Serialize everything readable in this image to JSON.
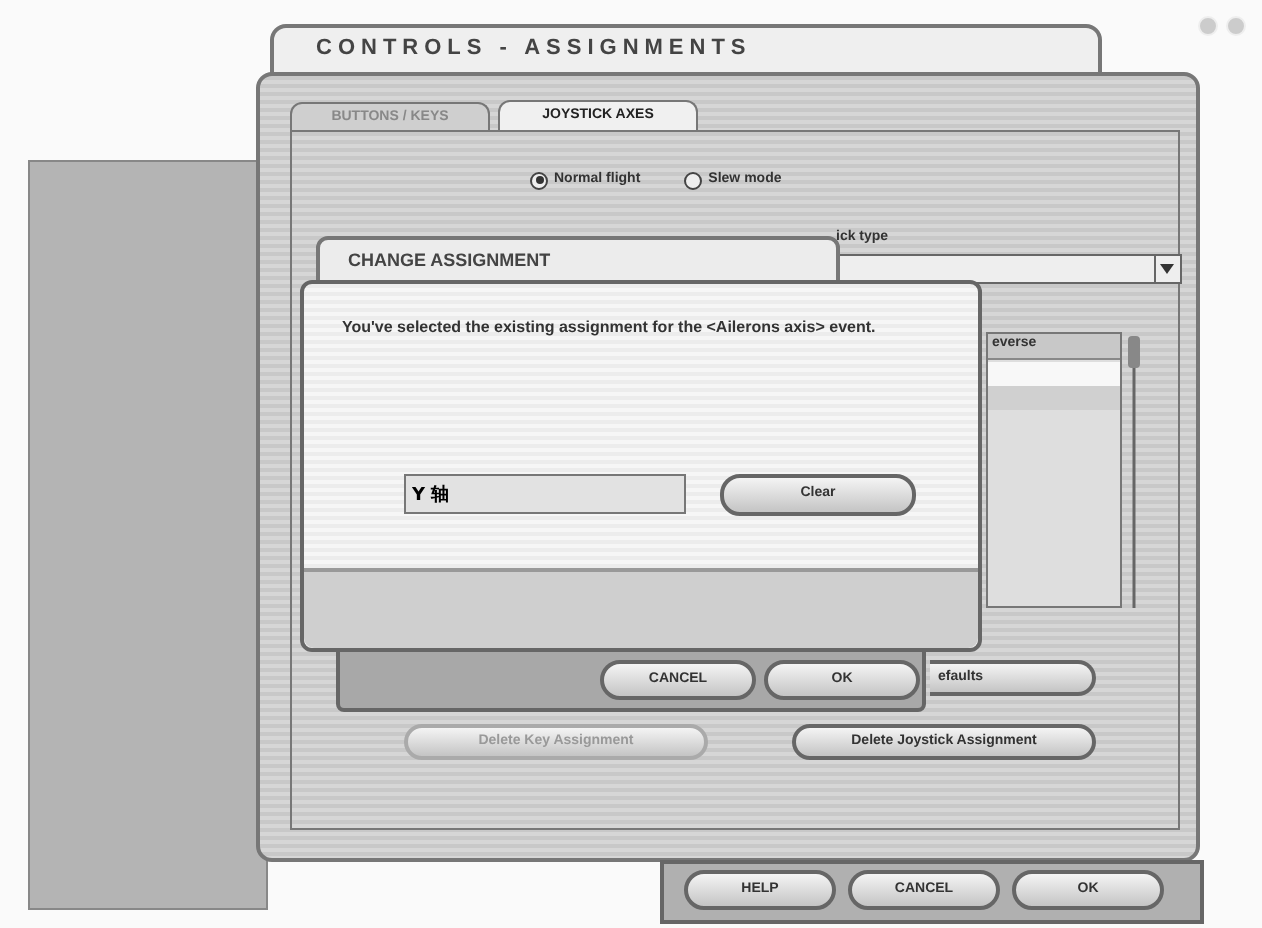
{
  "window": {
    "title": "CONTROLS - ASSIGNMENTS"
  },
  "tabs": [
    {
      "label": "BUTTONS / KEYS",
      "selected": false
    },
    {
      "label": "JOYSTICK AXES",
      "selected": true
    }
  ],
  "modes": [
    {
      "label": "Normal flight",
      "selected": true
    },
    {
      "label": "Slew mode",
      "selected": false
    }
  ],
  "joystick_type": {
    "label": "ick type"
  },
  "list": {
    "column": "everse",
    "rows": [
      {
        "selected": true
      },
      {
        "selected": false
      }
    ]
  },
  "reset_button": {
    "label": "efaults"
  },
  "delete_buttons": [
    {
      "label": "Delete Key Assignment",
      "disabled": true
    },
    {
      "label": "Delete Joystick Assignment",
      "disabled": false
    }
  ],
  "footer_buttons": [
    "HELP",
    "CANCEL",
    "OK"
  ],
  "change_dialog": {
    "title": "CHANGE ASSIGNMENT",
    "buttons": [
      "CANCEL",
      "OK"
    ]
  },
  "message_dialog": {
    "message": "You've selected the existing assignment for the <Ailerons axis> event.",
    "value": "Y 轴",
    "button": "Clear"
  }
}
